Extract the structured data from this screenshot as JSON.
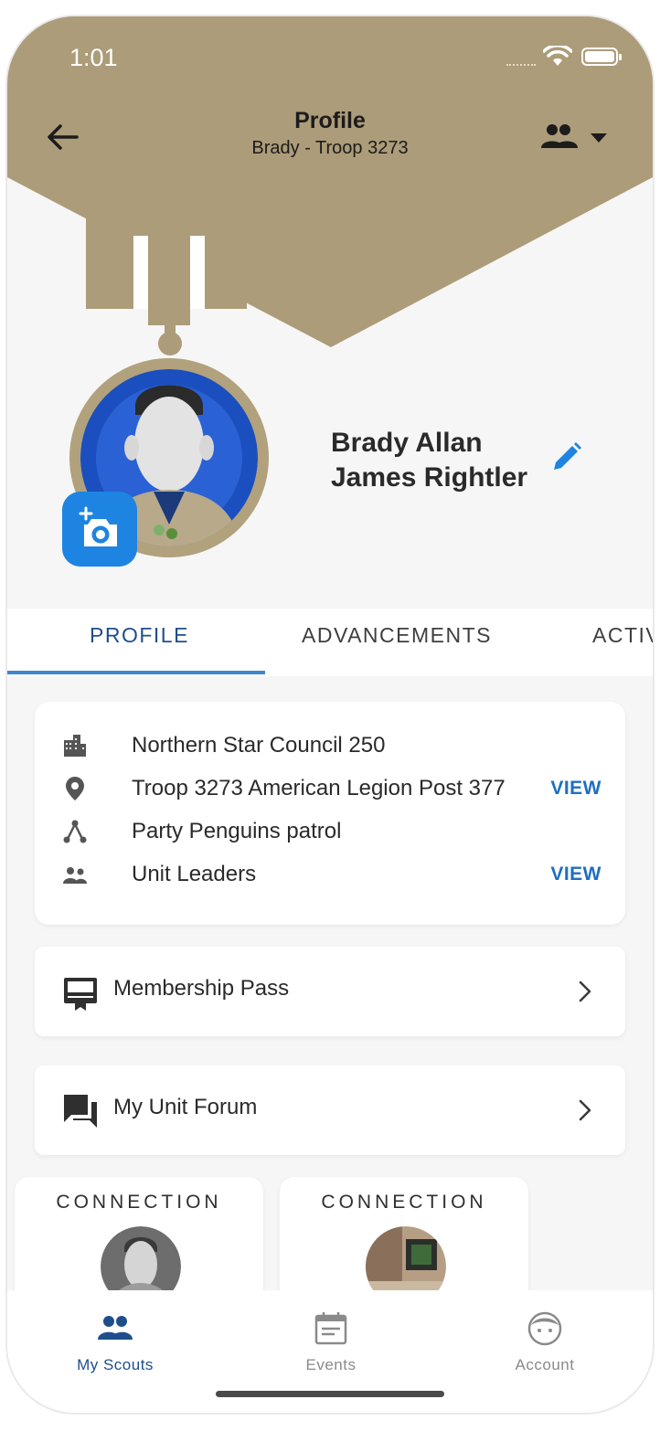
{
  "status_bar": {
    "time": "1:01"
  },
  "header": {
    "title": "Profile",
    "subtitle": "Brady - Troop 3273",
    "background_color": "#ac9c79"
  },
  "profile": {
    "name": "Brady Allan James Rightler",
    "accent_color": "#1e84e2"
  },
  "tabs": [
    {
      "label": "PROFILE",
      "active": true
    },
    {
      "label": "ADVANCEMENTS",
      "active": false
    },
    {
      "label": "ACTIV",
      "active": false
    }
  ],
  "info_card": {
    "rows": [
      {
        "icon": "building-icon",
        "label": "Northern Star Council 250",
        "action": ""
      },
      {
        "icon": "location-pin-icon",
        "label": "Troop 3273 American Legion Post 377",
        "action": "VIEW"
      },
      {
        "icon": "patrol-tree-icon",
        "label": "Party Penguins patrol",
        "action": ""
      },
      {
        "icon": "unit-leaders-icon",
        "label": "Unit Leaders",
        "action": "VIEW"
      }
    ]
  },
  "nav_cards": [
    {
      "icon": "membership-card-icon",
      "label": "Membership Pass"
    },
    {
      "icon": "forum-icon",
      "label": "My Unit Forum"
    }
  ],
  "connections": [
    {
      "title": "CONNECTION"
    },
    {
      "title": "CONNECTION"
    }
  ],
  "bottom_nav": [
    {
      "icon": "scouts-group-icon",
      "label": "My Scouts",
      "active": true,
      "color": "#1f4e8c"
    },
    {
      "icon": "calendar-icon",
      "label": "Events",
      "active": false,
      "color": "#8a8a8a"
    },
    {
      "icon": "account-face-icon",
      "label": "Account",
      "active": false,
      "color": "#8a8a8a"
    }
  ]
}
